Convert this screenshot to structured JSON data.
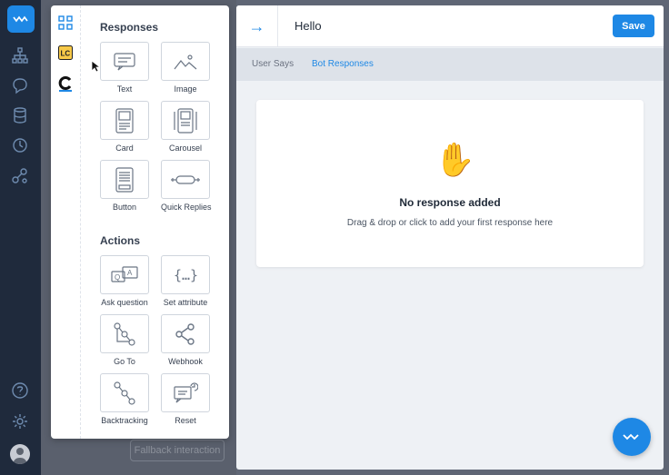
{
  "palette": {
    "responses_title": "Responses",
    "responses": [
      {
        "label": "Text",
        "icon": "text-message-icon"
      },
      {
        "label": "Image",
        "icon": "image-icon"
      },
      {
        "label": "Card",
        "icon": "card-icon"
      },
      {
        "label": "Carousel",
        "icon": "carousel-icon"
      },
      {
        "label": "Button",
        "icon": "button-icon"
      },
      {
        "label": "Quick Replies",
        "icon": "quick-replies-icon"
      }
    ],
    "actions_title": "Actions",
    "actions": [
      {
        "label": "Ask question",
        "icon": "ask-question-icon"
      },
      {
        "label": "Set attribute",
        "icon": "set-attribute-icon"
      },
      {
        "label": "Go To",
        "icon": "goto-icon"
      },
      {
        "label": "Webhook",
        "icon": "webhook-icon"
      },
      {
        "label": "Backtracking",
        "icon": "backtracking-icon"
      },
      {
        "label": "Reset",
        "icon": "reset-icon"
      }
    ]
  },
  "header": {
    "title": "Hello",
    "save_label": "Save"
  },
  "tabs": [
    {
      "label": "User Says",
      "active": false
    },
    {
      "label": "Bot Responses",
      "active": true
    }
  ],
  "empty_state": {
    "emoji": "✋",
    "title": "No response added",
    "subtitle": "Drag & drop or click to add your first response here"
  },
  "background": {
    "fallback_label": "Fallback interaction"
  },
  "colors": {
    "accent": "#1e88e5",
    "nav_bg": "#1f2a3c",
    "overlay": "#5f6675"
  }
}
